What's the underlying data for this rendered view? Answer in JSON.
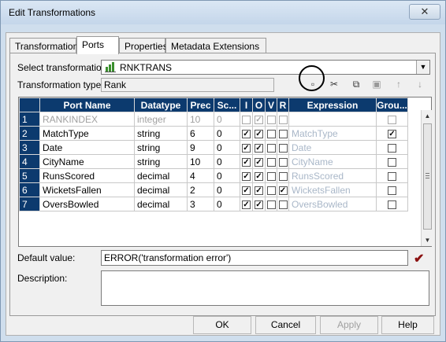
{
  "window": {
    "title": "Edit Transformations",
    "close_glyph": "✕"
  },
  "tabs": [
    {
      "label": "Transformation"
    },
    {
      "label": "Ports"
    },
    {
      "label": "Properties"
    },
    {
      "label": "Metadata Extensions"
    }
  ],
  "active_tab": "Ports",
  "select_transformation": {
    "label": "Select transformation:",
    "value": "RNKTRANS",
    "icon": "rank-transformation-icon"
  },
  "transformation_type": {
    "label": "Transformation type:",
    "value": "Rank"
  },
  "toolbar": [
    {
      "icon": "new-port-icon",
      "glyph": "▫"
    },
    {
      "icon": "cut-icon",
      "glyph": "✂"
    },
    {
      "icon": "copy-icon",
      "glyph": "⧉"
    },
    {
      "icon": "paste-icon",
      "glyph": "▣"
    },
    {
      "icon": "move-up-icon",
      "glyph": "↑"
    },
    {
      "icon": "move-down-icon",
      "glyph": "↓"
    }
  ],
  "grid": {
    "columns": [
      "Port Name",
      "Datatype",
      "Prec",
      "Sc...",
      "I",
      "O",
      "V",
      "R",
      "Expression",
      "Grou..."
    ],
    "rows": [
      {
        "num": "1",
        "port": "RANKINDEX",
        "datatype": "integer",
        "prec": "10",
        "scale": "0",
        "i": false,
        "o": true,
        "v": false,
        "r": false,
        "expression": "",
        "group": false,
        "disabled": true
      },
      {
        "num": "2",
        "port": "MatchType",
        "datatype": "string",
        "prec": "6",
        "scale": "0",
        "i": true,
        "o": true,
        "v": false,
        "r": false,
        "expression": "MatchType",
        "group": true,
        "disabled": false
      },
      {
        "num": "3",
        "port": "Date",
        "datatype": "string",
        "prec": "9",
        "scale": "0",
        "i": true,
        "o": true,
        "v": false,
        "r": false,
        "expression": "Date",
        "group": false,
        "disabled": false
      },
      {
        "num": "4",
        "port": "CityName",
        "datatype": "string",
        "prec": "10",
        "scale": "0",
        "i": true,
        "o": true,
        "v": false,
        "r": false,
        "expression": "CityName",
        "group": false,
        "disabled": false
      },
      {
        "num": "5",
        "port": "RunsScored",
        "datatype": "decimal",
        "prec": "4",
        "scale": "0",
        "i": true,
        "o": true,
        "v": false,
        "r": false,
        "expression": "RunsScored",
        "group": false,
        "disabled": false
      },
      {
        "num": "6",
        "port": "WicketsFallen",
        "datatype": "decimal",
        "prec": "2",
        "scale": "0",
        "i": true,
        "o": true,
        "v": false,
        "r": true,
        "expression": "WicketsFallen",
        "group": false,
        "disabled": false
      },
      {
        "num": "7",
        "port": "OversBowled",
        "datatype": "decimal",
        "prec": "3",
        "scale": "0",
        "i": true,
        "o": true,
        "v": false,
        "r": false,
        "expression": "OversBowled",
        "group": false,
        "disabled": false
      }
    ]
  },
  "default_value": {
    "label": "Default value:",
    "value": "ERROR('transformation error')",
    "validate_glyph": "✔"
  },
  "description": {
    "label": "Description:",
    "value": ""
  },
  "buttons": {
    "ok": "OK",
    "cancel": "Cancel",
    "apply": "Apply",
    "help": "Help"
  },
  "colors": {
    "grid_header": "#0c3a6e",
    "validate_mark": "#8a1010",
    "annotation_circle": "#000000"
  }
}
